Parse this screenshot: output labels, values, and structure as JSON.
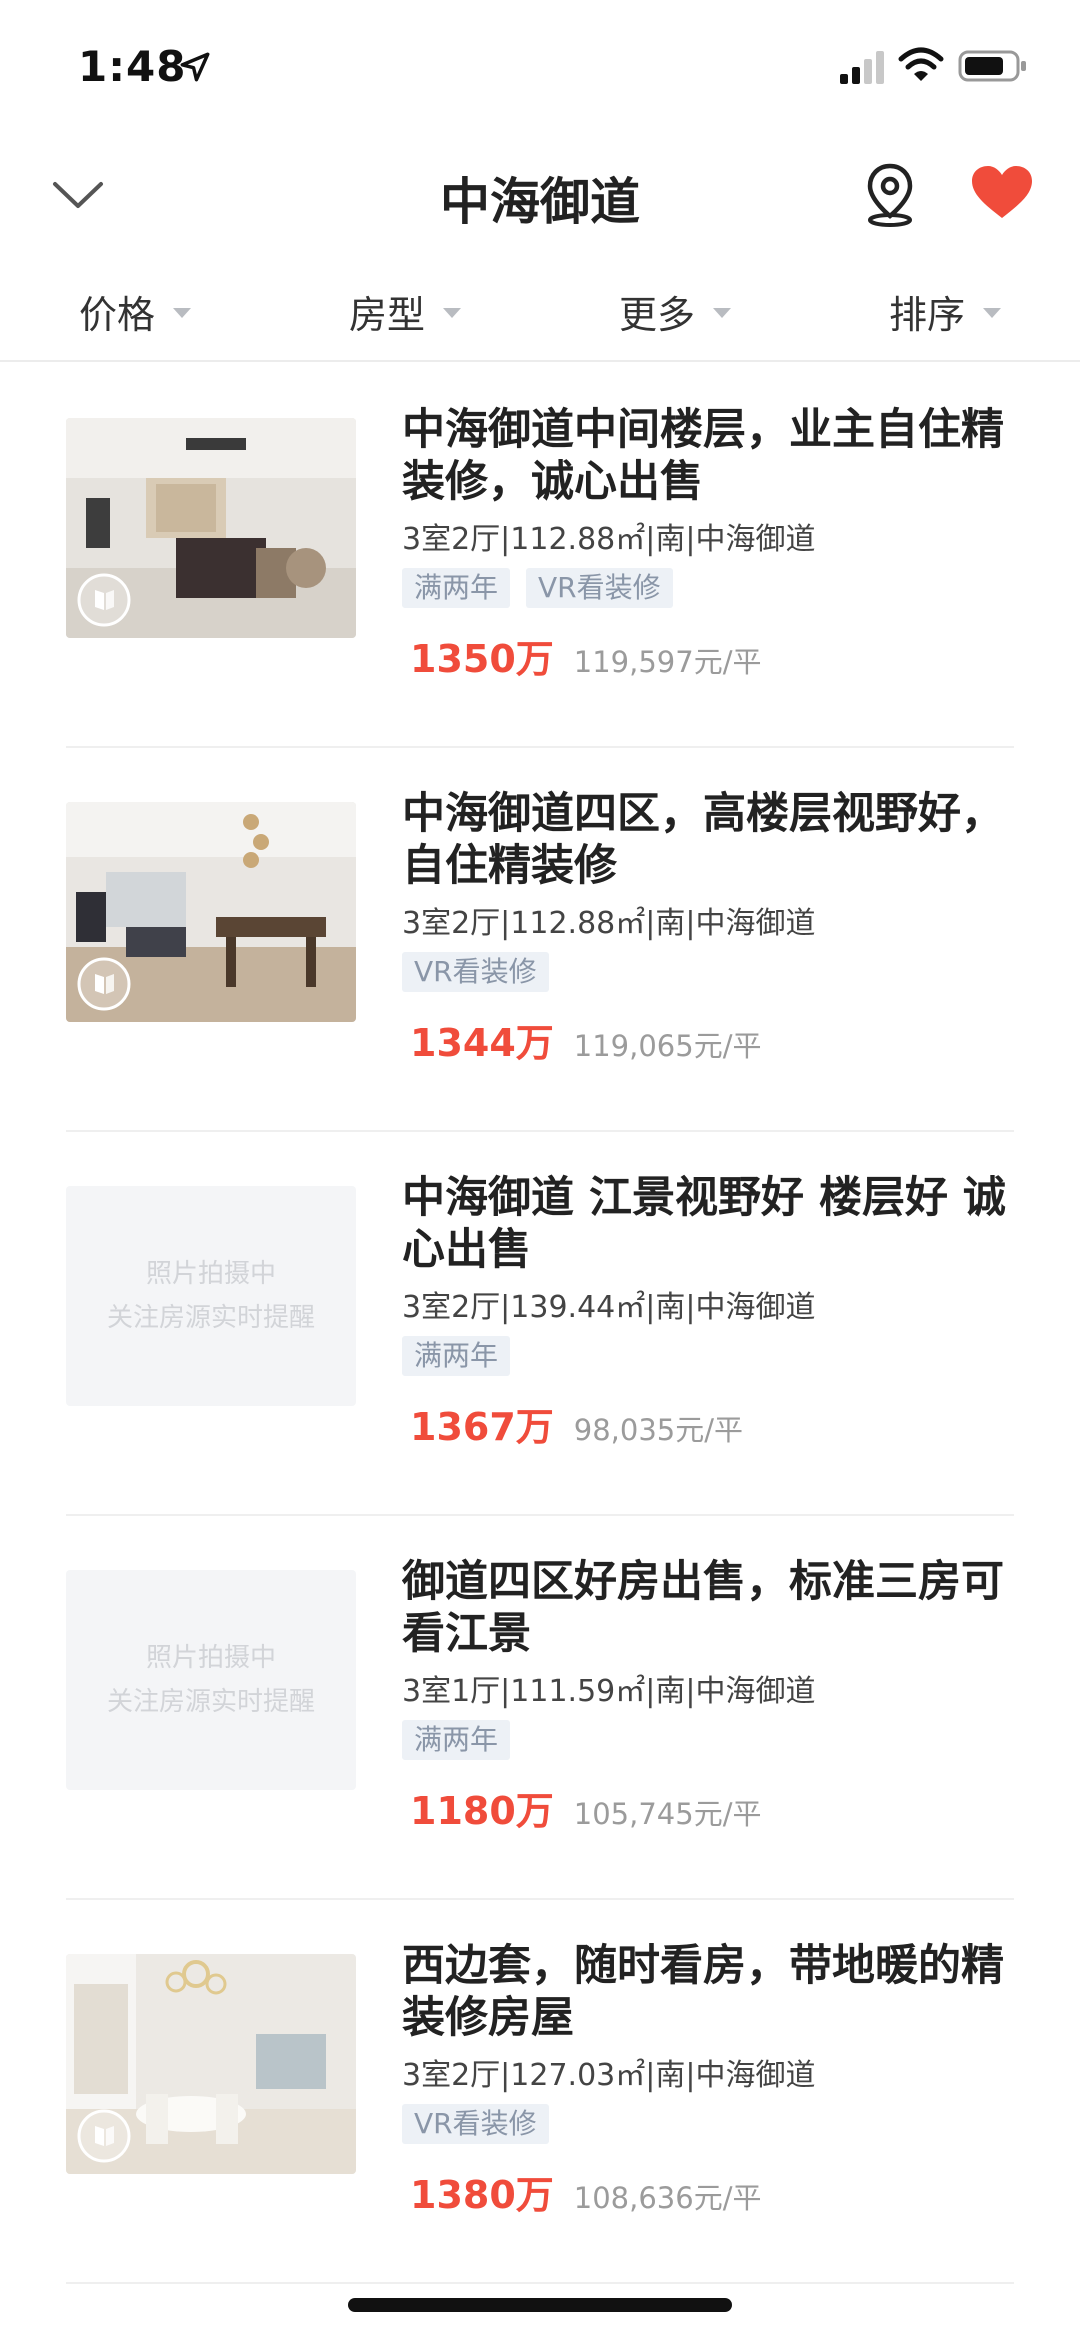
{
  "status_bar": {
    "time": "1:48"
  },
  "header": {
    "title": "中海御道"
  },
  "filters": [
    "价格",
    "房型",
    "更多",
    "排序"
  ],
  "colors": {
    "accent_red": "#f04c3b",
    "heart": "#f04c3b",
    "tag_bg": "#edf1f6",
    "tag_text": "#8a96a8"
  },
  "listings": [
    {
      "title": "中海御道中间楼层，业主自住精装修，诚心出售",
      "meta": "3室2厅|112.88㎡|南|中海御道",
      "tags": [
        "满两年",
        "VR看装修"
      ],
      "price": "1350万",
      "unit_price": "119,597元/平",
      "has_photo": true,
      "icon": "vr-icon"
    },
    {
      "title": "中海御道四区，高楼层视野好，自住精装修",
      "meta": "3室2厅|112.88㎡|南|中海御道",
      "tags": [
        "VR看装修"
      ],
      "price": "1344万",
      "unit_price": "119,065元/平",
      "has_photo": true,
      "icon": "vr-icon"
    },
    {
      "title": "中海御道 江景视野好 楼层好 诚心出售",
      "meta": "3室2厅|139.44㎡|南|中海御道",
      "tags": [
        "满两年"
      ],
      "price": "1367万",
      "unit_price": "98,035元/平",
      "has_photo": false,
      "placeholder": [
        "照片拍摄中",
        "关注房源实时提醒"
      ]
    },
    {
      "title": "御道四区好房出售，标准三房可看江景",
      "meta": "3室1厅|111.59㎡|南|中海御道",
      "tags": [
        "满两年"
      ],
      "price": "1180万",
      "unit_price": "105,745元/平",
      "has_photo": false,
      "placeholder": [
        "照片拍摄中",
        "关注房源实时提醒"
      ]
    },
    {
      "title": "西边套，随时看房，带地暖的精装修房屋",
      "meta": "3室2厅|127.03㎡|南|中海御道",
      "tags": [
        "VR看装修"
      ],
      "price": "1380万",
      "unit_price": "108,636元/平",
      "has_photo": true,
      "icon": "vr-icon"
    }
  ]
}
